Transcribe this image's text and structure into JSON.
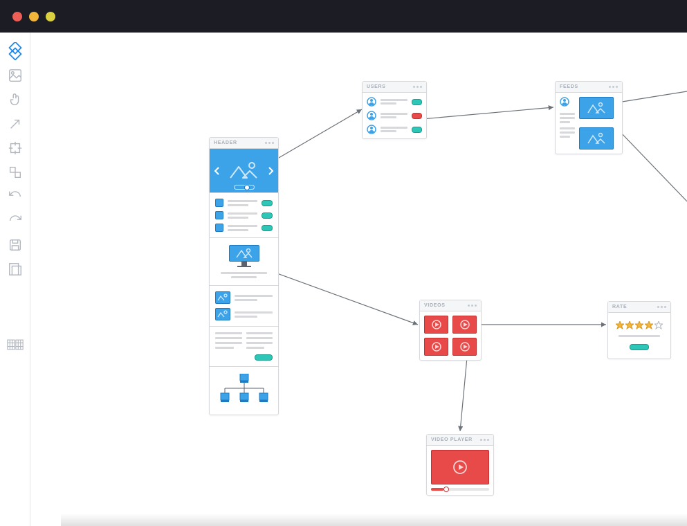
{
  "titlebar": {
    "close": "#ec5e56",
    "min": "#f3b63a",
    "max": "#dacf3e"
  },
  "cards": {
    "header": {
      "title": "HEADER"
    },
    "users": {
      "title": "USERS"
    },
    "feeds": {
      "title": "FEEDS"
    },
    "videos": {
      "title": "VIDEOS"
    },
    "rate": {
      "title": "RATE"
    },
    "video_player": {
      "title": "VIDEO PLAYER"
    }
  },
  "sidebar_icons": [
    "logo-icon",
    "image-icon",
    "tap-icon",
    "arrow-ne-icon",
    "crop-icon",
    "elements-icon",
    "undo-icon",
    "redo-icon",
    "save-icon",
    "artboard-icon"
  ],
  "bottom_icon": "grid-icon"
}
